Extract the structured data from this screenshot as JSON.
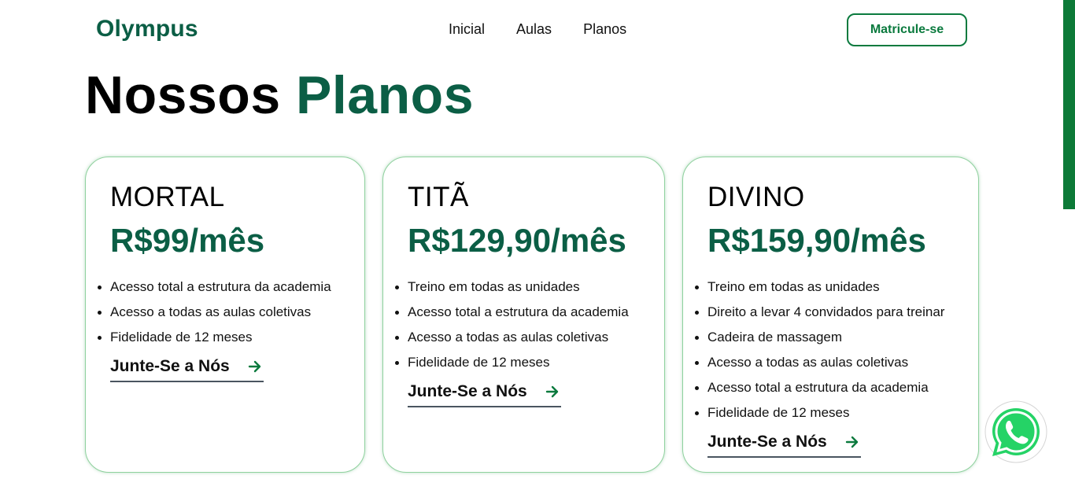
{
  "header": {
    "logo": "Olympus",
    "nav": [
      "Inicial",
      "Aulas",
      "Planos"
    ],
    "cta_label": "Matricule-se"
  },
  "section": {
    "title_part1": "Nossos",
    "title_part2": "Planos"
  },
  "plans": [
    {
      "name": "MORTAL",
      "price": "R$99/mês",
      "features": [
        "Acesso total a estrutura da academia",
        "Acesso a todas as aulas coletivas",
        "Fidelidade de 12 meses"
      ],
      "cta": "Junte-Se a Nós"
    },
    {
      "name": "TITÃ",
      "price": "R$129,90/mês",
      "features": [
        "Treino em todas as unidades",
        "Acesso total a estrutura da academia",
        "Acesso a todas as aulas coletivas",
        "Fidelidade de 12 meses"
      ],
      "cta": "Junte-Se a Nós"
    },
    {
      "name": "DIVINO",
      "price": "R$159,90/mês",
      "features": [
        "Treino em todas as unidades",
        "Direito a levar 4 convidados para treinar",
        "Cadeira de massagem",
        "Acesso a todas as aulas coletivas",
        "Acesso total a estrutura da academia",
        "Fidelidade de 12 meses"
      ],
      "cta": "Junte-Se a Nós"
    }
  ],
  "colors": {
    "brand_green": "#0b5e45",
    "cta_green": "#0b7a3e",
    "card_border": "#8fd19e",
    "whatsapp_green": "#25d366"
  },
  "icons": {
    "join_arrow": "arrow-right-icon",
    "floating": "whatsapp-icon"
  }
}
